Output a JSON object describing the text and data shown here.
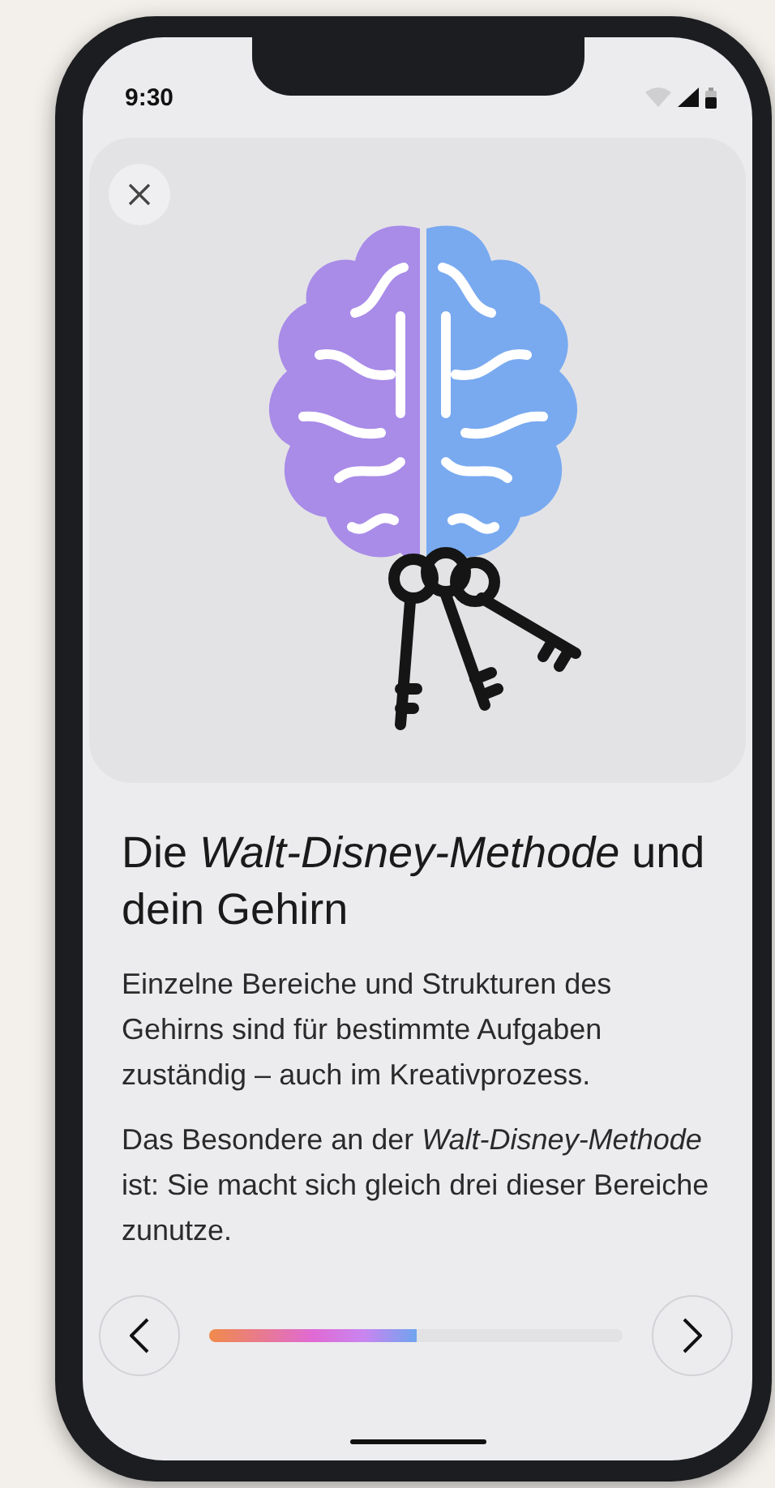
{
  "status_bar": {
    "time": "9:30"
  },
  "title": "Die *Walt-Disney-Methode* und dein Gehirn",
  "paragraphs": [
    "Einzelne Bereiche und Strukturen des Gehirns sind für bestimmte Aufgaben zuständig – auch im Kreativprozess.",
    "Das Besondere an der *Walt-Disney-Methode* ist: Sie macht sich gleich drei dieser Bereiche zunutze."
  ],
  "progress": {
    "level": 0.5
  }
}
